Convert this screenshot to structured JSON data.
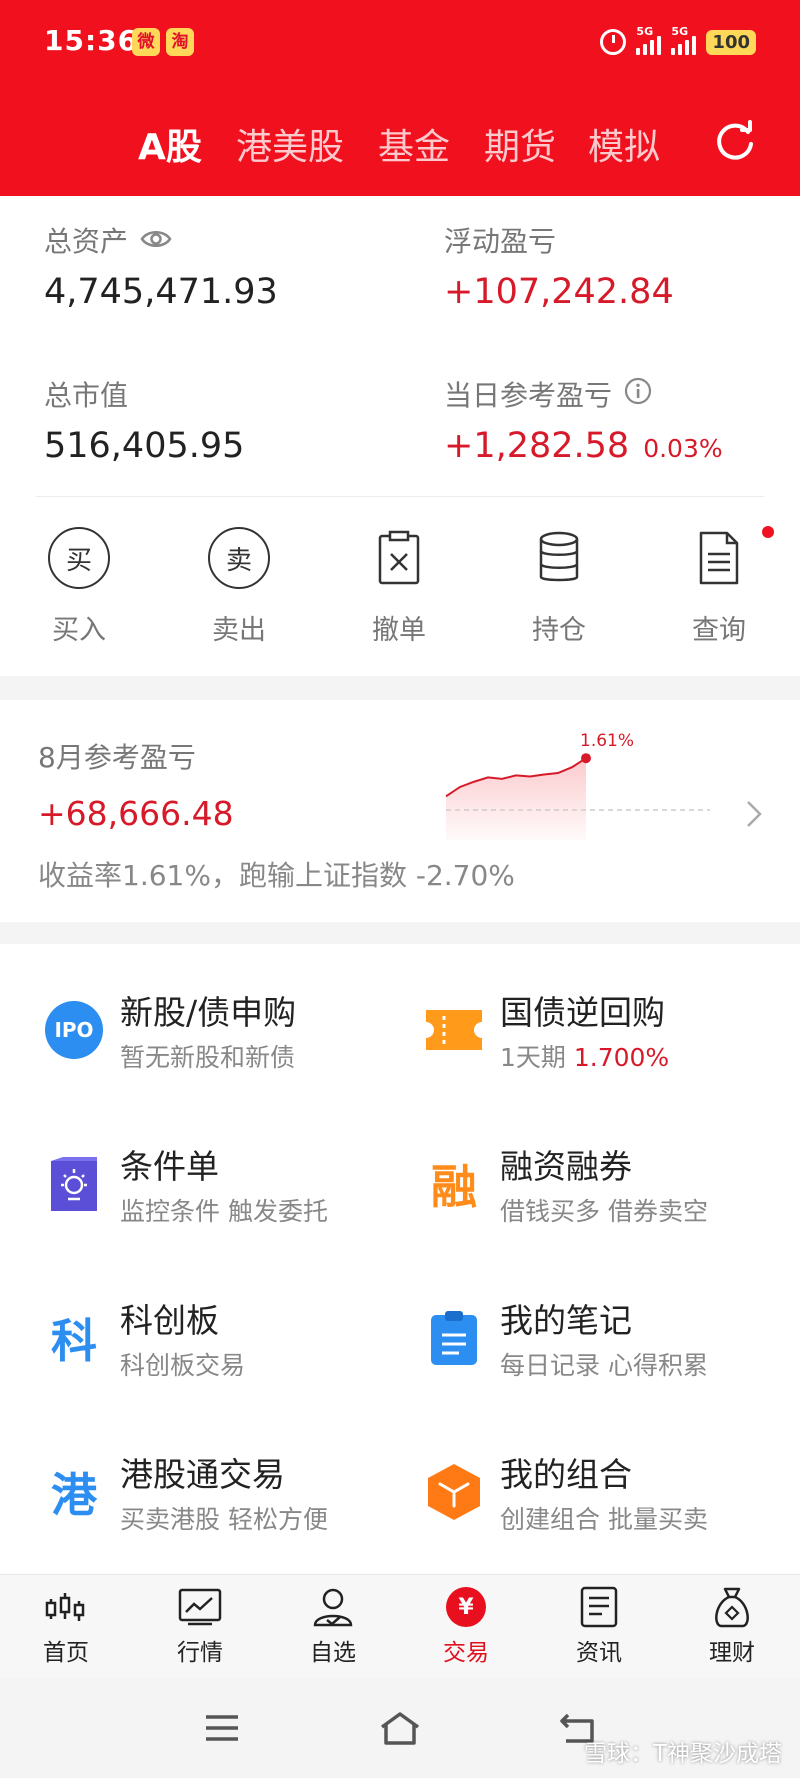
{
  "status_bar": {
    "time": "15:36",
    "app_badge_1": "微",
    "app_badge_2": "淘",
    "signal_1": "5G",
    "signal_2": "5G",
    "battery": "100"
  },
  "tabs": [
    {
      "label": "A股",
      "active": true
    },
    {
      "label": "港美股"
    },
    {
      "label": "基金"
    },
    {
      "label": "期货"
    },
    {
      "label": "模拟"
    }
  ],
  "assets": {
    "total_assets_label": "总资产",
    "total_assets": "4,745,471.93",
    "floating_pl_label": "浮动盈亏",
    "floating_pl": "+107,242.84",
    "market_value_label": "总市值",
    "market_value": "516,405.95",
    "daily_pl_label": "当日参考盈亏",
    "daily_pl": "+1,282.58",
    "daily_pl_pct": "0.03%"
  },
  "actions": [
    {
      "label": "买入",
      "glyph": "买"
    },
    {
      "label": "卖出",
      "glyph": "卖"
    },
    {
      "label": "撤单"
    },
    {
      "label": "持仓"
    },
    {
      "label": "查询"
    }
  ],
  "monthly": {
    "title": "8月参考盈亏",
    "value": "+68,666.48",
    "summary": "收益率1.61%，跑输上证指数 -2.70%",
    "chart_peak_label": "1.61%",
    "chart_values": [
      0.3,
      0.62,
      0.8,
      0.95,
      0.9,
      1.02,
      0.98,
      1.05,
      1.1,
      1.3,
      1.61
    ]
  },
  "services": [
    {
      "title": "新股/债申购",
      "subtitle": "暂无新股和新债",
      "icon": "IPO"
    },
    {
      "title": "国债逆回购",
      "subtitle_prefix": "1天期",
      "subtitle_highlight": "1.700%"
    },
    {
      "title": "条件单",
      "subtitle": "监控条件 触发委托"
    },
    {
      "title": "融资融券",
      "subtitle": "借钱买多 借券卖空",
      "icon": "融"
    },
    {
      "title": "科创板",
      "subtitle": "科创板交易",
      "icon": "科"
    },
    {
      "title": "我的笔记",
      "subtitle": "每日记录 心得积累"
    },
    {
      "title": "港股通交易",
      "subtitle": "买卖港股 轻松方便",
      "icon": "港"
    },
    {
      "title": "我的组合",
      "subtitle": "创建组合 批量买卖"
    }
  ],
  "bottom_nav": [
    {
      "label": "首页"
    },
    {
      "label": "行情"
    },
    {
      "label": "自选"
    },
    {
      "label": "交易",
      "active": true,
      "glyph": "¥"
    },
    {
      "label": "资讯"
    },
    {
      "label": "理财"
    }
  ],
  "watermark": "雪球：T神聚沙成塔",
  "colors": {
    "brand_red": "#f0101e",
    "gain_red": "#d71a2a",
    "ipo_blue": "#2b8ef0",
    "orange": "#ff8c1a",
    "purple": "#5a4fd6"
  }
}
